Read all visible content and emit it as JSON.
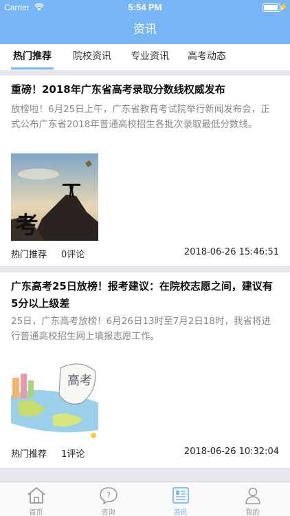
{
  "status_bar": {
    "carrier": "Carrier",
    "time": "5:54 PM",
    "battery_level": 0.92
  },
  "nav": {
    "title": "资讯"
  },
  "tabs": [
    {
      "label": "热门推荐",
      "active": true
    },
    {
      "label": "院校资讯",
      "active": false
    },
    {
      "label": "专业资讯",
      "active": false
    },
    {
      "label": "高考动态",
      "active": false
    }
  ],
  "articles": [
    {
      "title": "重磅！2018年广东省高考录取分数线权威发布",
      "summary": "放榜啦！6月25日上午，广东省教育考试院举行新闻发布会，正式公布广东省2018年普通高校招生各批次录取最低分数线。",
      "category": "热门推荐",
      "comments": "0评论",
      "time": "2018-06-26 15:46:51",
      "thumb_text": "考"
    },
    {
      "title": "广东高考25日放榜！报考建议：在院校志愿之间，建议有5分以上级差",
      "summary": "25日，广东高考放榜！6月26日13时至7月2日18时，我省将进行普通高校招生网上填报志愿工作。",
      "category": "热门推荐",
      "comments": "1评论",
      "time": "2018-06-26 10:32:04",
      "thumb_text": "高考"
    }
  ],
  "tabbar": [
    {
      "label": "首页",
      "icon": "home-icon",
      "active": false
    },
    {
      "label": "咨询",
      "icon": "question-bubble-icon",
      "active": false
    },
    {
      "label": "资讯",
      "icon": "newspaper-icon",
      "active": true
    },
    {
      "label": "我的",
      "icon": "person-icon",
      "active": false
    }
  ],
  "colors": {
    "primary": "#77b5f5",
    "background": "#efeff4"
  }
}
